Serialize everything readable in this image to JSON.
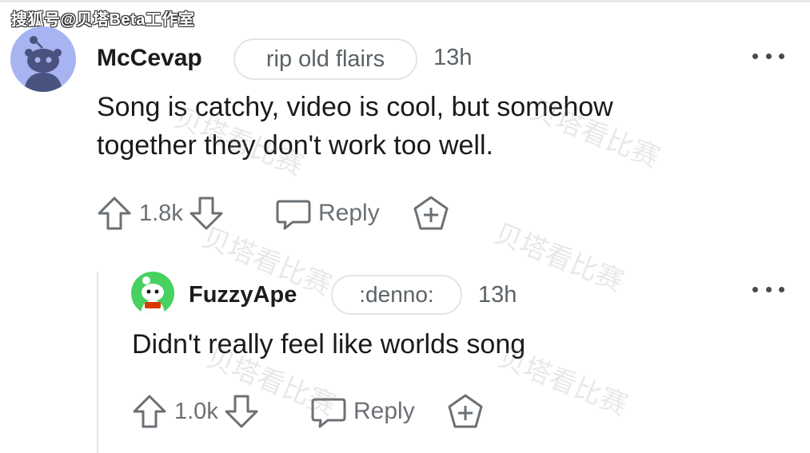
{
  "source_watermark": "搜狐号@贝塔Beta工作室",
  "overlay_watermark": "贝塔看比赛",
  "comments": [
    {
      "username": "McCevap",
      "flair": "rip old flairs",
      "time": "13h",
      "body_line1": "Song is catchy, video is cool, but somehow",
      "body_line2": "together they don't work too well.",
      "score": "1.8k",
      "reply_label": "Reply"
    },
    {
      "username": "FuzzyApe",
      "flair": ":denno:",
      "time": "13h",
      "body_line1": "Didn't really feel like worlds song",
      "score": "1.0k",
      "reply_label": "Reply"
    }
  ],
  "colors": {
    "avatar_main": "#a8b3f2",
    "avatar_small": "#46d160",
    "meta": "#5b6266"
  }
}
